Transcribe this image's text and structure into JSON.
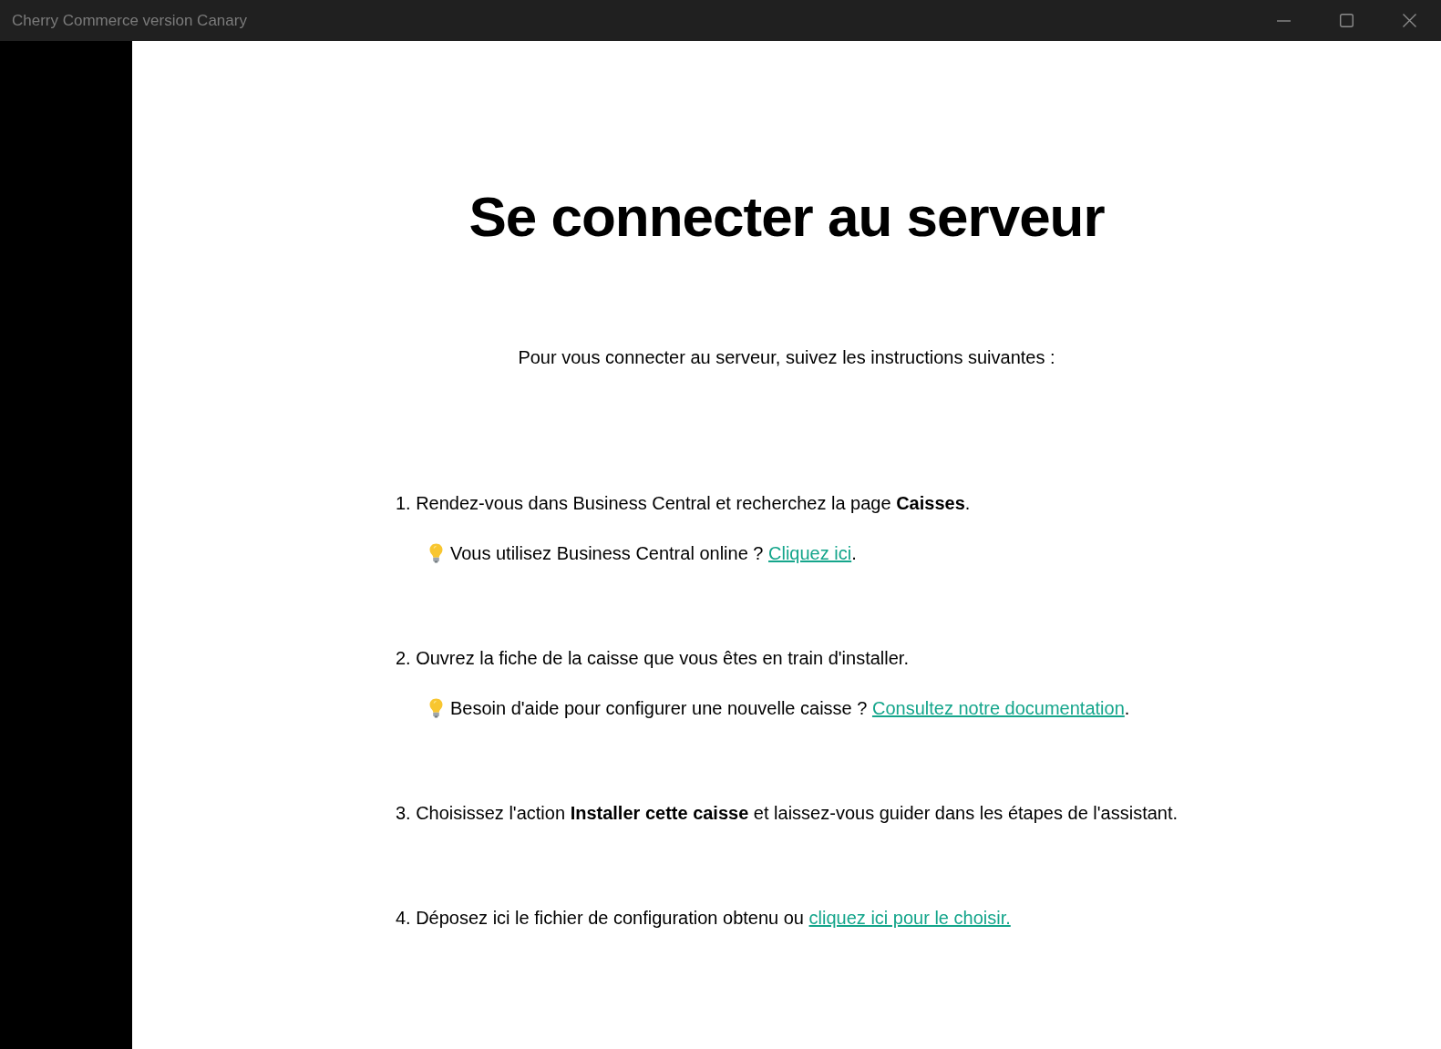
{
  "window": {
    "title": "Cherry Commerce version Canary"
  },
  "heading": "Se connecter au serveur",
  "intro": "Pour vous connecter au serveur, suivez les instructions suivantes :",
  "steps": [
    {
      "text": "1. Rendez-vous dans Business Central et recherchez la page **Caisses**.",
      "tip": {
        "text": "Vous utilisez Business Central online ?",
        "link": "Cliquez ici",
        "after": "."
      }
    },
    {
      "text": "2. Ouvrez la fiche de la caisse que vous êtes en train d'installer.",
      "tip": {
        "text": "Besoin d'aide pour configurer une nouvelle caisse ?",
        "link": "Consultez notre documentation",
        "after": "."
      }
    },
    {
      "text": "3. Choisissez l'action **Installer cette caisse** et laissez-vous guider dans les étapes de l'assistant."
    },
    {
      "text": "4. Déposez ici le fichier de configuration obtenu ou",
      "link": "cliquez ici pour le choisir."
    }
  ]
}
